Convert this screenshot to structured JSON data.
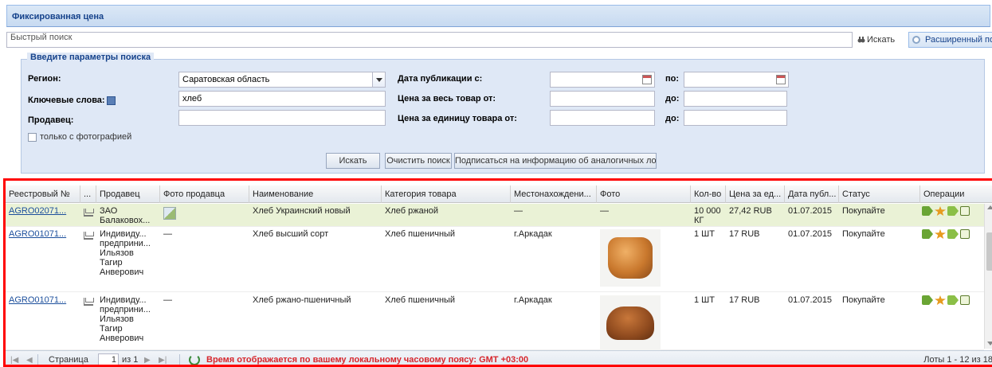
{
  "panel": {
    "title": "Фиксированная цена"
  },
  "quick_search": {
    "placeholder": "Быстрый поиск",
    "search_label": "Искать",
    "advanced_label": "Расширенный поиск"
  },
  "params": {
    "legend": "Введите параметры поиска",
    "region_label": "Регион:",
    "region_value": "Саратовская область",
    "keywords_label": "Ключевые слова:",
    "keywords_value": "хлеб",
    "seller_label": "Продавец:",
    "seller_value": "",
    "pub_date_from_label": "Дата публикации с:",
    "pub_date_to_label": "по:",
    "total_price_from_label": "Цена за весь товар от:",
    "total_price_to_label": "до:",
    "unit_price_from_label": "Цена за единицу товара от:",
    "unit_price_to_label": "до:",
    "photo_only_label": "только с фотографией",
    "search_btn": "Искать",
    "clear_btn": "Очистить поиск",
    "subscribe_btn": "Подписаться на информацию об аналогичных лотах"
  },
  "grid": {
    "columns": [
      "Реестровый №",
      "...",
      "Продавец",
      "Фото продавца",
      "Наименование",
      "Категория товара",
      "Местонахождени...",
      "Фото",
      "Кол-во",
      "Цена за ед...",
      "Дата публ...",
      "Статус",
      "Операции"
    ],
    "rows": [
      {
        "reg_no": "AGRO02071...",
        "seller": "ЗАО Балаковох...",
        "seller_photo": "",
        "name": "Хлеб Украинский новый",
        "category": "Хлеб ржаной",
        "location": "—",
        "photo": "—",
        "qty": "10 000 КГ",
        "price": "27,42 RUB",
        "date": "01.07.2015",
        "status": "Покупайте"
      },
      {
        "reg_no": "AGRO01071...",
        "seller": "Индивиду... предприни... Ильязов Тагир Анверович",
        "seller_photo": "—",
        "name": "Хлеб высший сорт",
        "category": "Хлеб пшеничный",
        "location": "г.Аркадак",
        "photo": "",
        "qty": "1 ШТ",
        "price": "17 RUB",
        "date": "01.07.2015",
        "status": "Покупайте"
      },
      {
        "reg_no": "AGRO01071...",
        "seller": "Индивиду... предприни... Ильязов Тагир Анверович",
        "seller_photo": "—",
        "name": "Хлеб ржано-пшеничный",
        "category": "Хлеб пшеничный",
        "location": "г.Аркадак",
        "photo": "",
        "qty": "1 ШТ",
        "price": "17 RUB",
        "date": "01.07.2015",
        "status": "Покупайте"
      }
    ]
  },
  "paging": {
    "page_label": "Страница",
    "page_value": "1",
    "of_label": "из 1",
    "timezone_note": "Время отображается по вашему локальному часовому поясу: GMT +03:00",
    "lots_info": "Лоты 1 - 12 из 18"
  },
  "colors": {
    "selection_bg": "#eaf2d6",
    "highlight_border": "#ff0000",
    "link": "#1c4f9c",
    "tz_note": "#d7262c"
  },
  "icons": [
    "binoculars-icon",
    "gear-icon",
    "help-icon",
    "calendar-icon",
    "cart-icon",
    "broken-image-icon",
    "tag-icon",
    "star-icon",
    "lock-icon",
    "refresh-icon"
  ]
}
